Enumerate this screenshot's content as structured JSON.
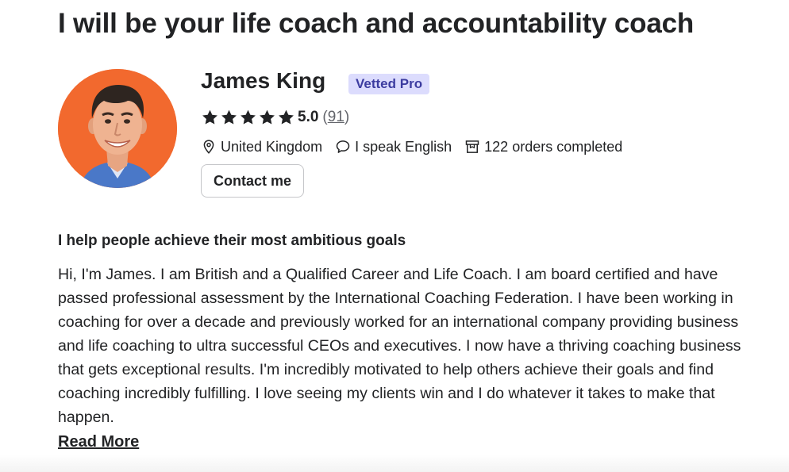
{
  "gig": {
    "title": "I will be your life coach and accountability coach"
  },
  "seller": {
    "name": "James King",
    "badge": "Vetted Pro",
    "rating": "5.0",
    "stars": 5,
    "review_count": "91",
    "review_open": "(",
    "review_close": ")",
    "location": "United Kingdom",
    "languages": "I speak English",
    "orders": "122 orders completed",
    "contact_label": "Contact me",
    "avatar_bg": "#f2692e"
  },
  "about": {
    "heading": "I help people achieve their most ambitious goals",
    "body": "Hi, I'm James. I am British and a Qualified Career and Life Coach. I am board certified and have passed professional assessment by the International Coaching Federation. I have been working in coaching for over a decade and previously worked for an international company providing business and life coaching to ultra successful CEOs and executives. I now have a thriving coaching business that gets exceptional results. I'm incredibly motivated to help others achieve their goals and find coaching incredibly fulfilling. I love seeing my clients win and I do whatever it takes to make that happen.",
    "read_more": "Read More"
  },
  "icons": {
    "star": "star-icon",
    "location": "location-pin-icon",
    "language": "speech-bubble-icon",
    "orders": "orders-box-icon"
  }
}
